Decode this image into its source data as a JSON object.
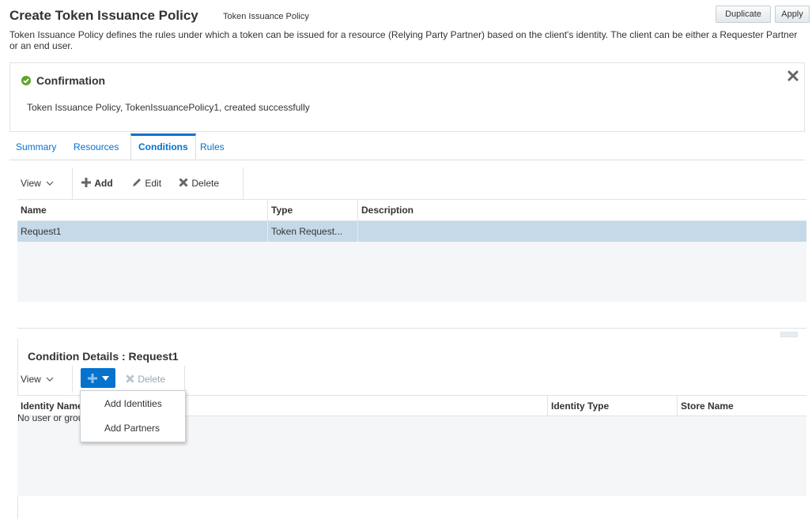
{
  "header": {
    "title": "Create Token Issuance Policy",
    "subtitle": "Token Issuance Policy",
    "duplicate_label": "Duplicate",
    "apply_label": "Apply",
    "description": "Token Issuance Policy defines the rules under which a token can be issued for a resource (Relying Party Partner) based on the client's identity. The client can be either a Requester Partner or an end user."
  },
  "confirmation": {
    "title": "Confirmation",
    "message": "Token Issuance Policy, TokenIssuancePolicy1, created successfully",
    "icon": "check-circle-icon",
    "color": "#5ea32b"
  },
  "tabs": [
    {
      "label": "Summary"
    },
    {
      "label": "Resources"
    },
    {
      "label": "Conditions",
      "active": true
    },
    {
      "label": "Rules"
    }
  ],
  "conditions_toolbar": {
    "view_label": "View",
    "add_label": "Add",
    "edit_label": "Edit",
    "delete_label": "Delete"
  },
  "conditions_table": {
    "columns": [
      "Name",
      "Type",
      "Description"
    ],
    "rows": [
      {
        "name": "Request1",
        "type": "Token Request...",
        "description": "",
        "selected": true
      }
    ]
  },
  "details": {
    "title": "Condition Details : Request1",
    "view_label": "View",
    "delete_label": "Delete",
    "columns": [
      "Identity Name",
      "Identity Type",
      "Store Name"
    ],
    "empty_message": "No user or group"
  },
  "add_menu": {
    "items": [
      "Add Identities",
      "Add Partners"
    ]
  },
  "colors": {
    "accent": "#0572ce",
    "selected_row": "#c5d9e8"
  }
}
